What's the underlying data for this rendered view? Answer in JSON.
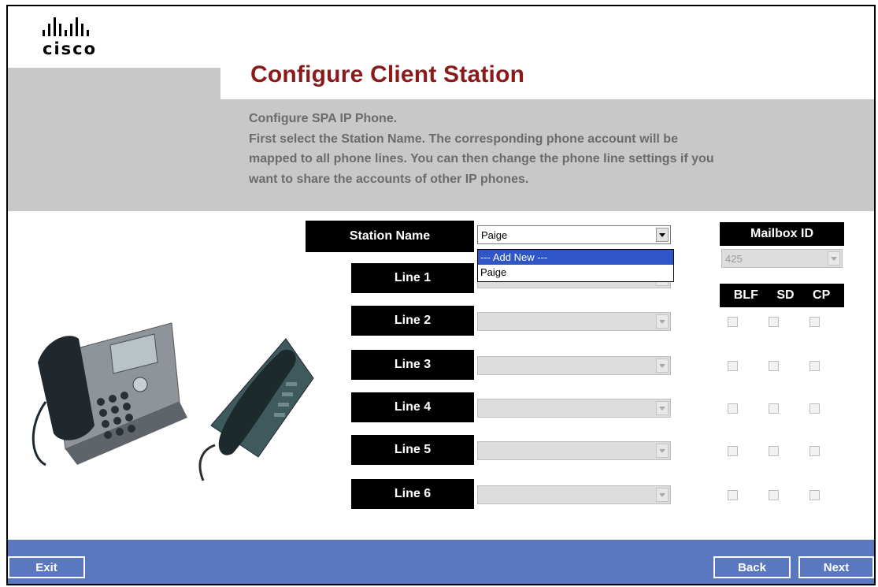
{
  "brand": {
    "logo_text": "cisco"
  },
  "header": {
    "title": "Configure Client Station"
  },
  "intro": {
    "lines": [
      "Configure SPA IP Phone.",
      "First select the Station Name. The corresponding phone account will be",
      "mapped to all phone lines. You can then change the phone line settings if you",
      "want to share the accounts of other IP phones."
    ]
  },
  "station": {
    "label": "Station Name",
    "selected": "Paige",
    "options": [
      "--- Add New ---",
      "Paige"
    ]
  },
  "mailbox": {
    "label": "Mailbox ID",
    "value": "425"
  },
  "flags": {
    "blf": "BLF",
    "sd": "SD",
    "cp": "CP"
  },
  "lines": [
    {
      "label": "Line 1"
    },
    {
      "label": "Line 2"
    },
    {
      "label": "Line 3"
    },
    {
      "label": "Line 4"
    },
    {
      "label": "Line 5"
    },
    {
      "label": "Line 6"
    }
  ],
  "footer": {
    "exit": "Exit",
    "back": "Back",
    "next": "Next"
  },
  "colors": {
    "title": "#8b1a1a",
    "band": "#c8c8c8",
    "footer": "#5a78c0",
    "highlight": "#2f56c6"
  }
}
